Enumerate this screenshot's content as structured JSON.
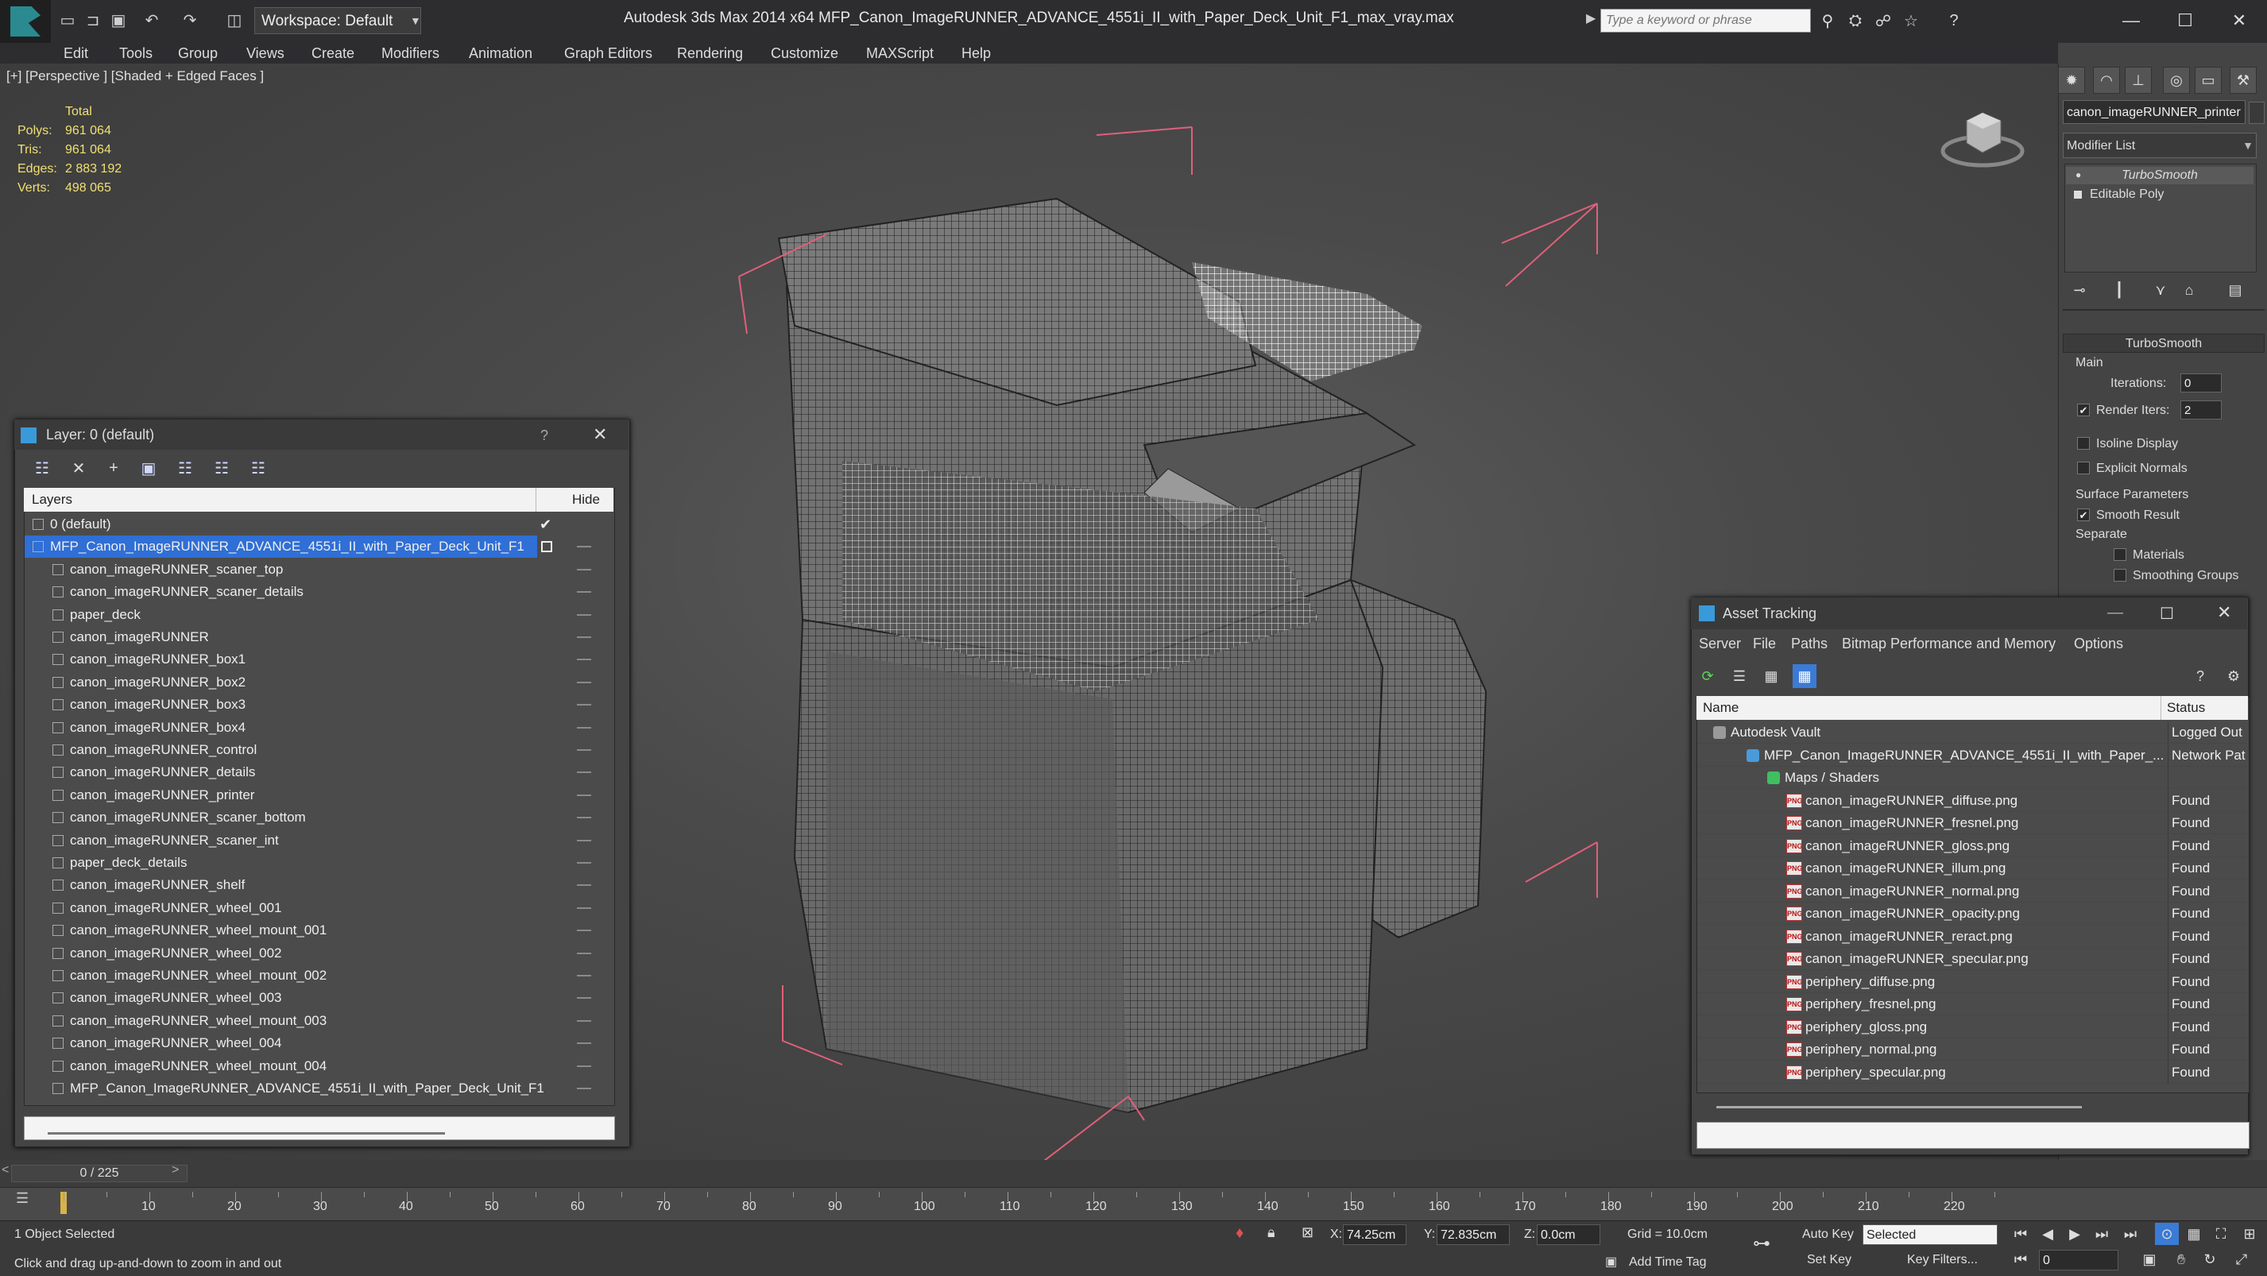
{
  "app": {
    "title": "Autodesk 3ds Max  2014 x64     MFP_Canon_ImageRUNNER_ADVANCE_4551i_II_with_Paper_Deck_Unit_F1_max_vray.max",
    "workspace": "Workspace: Default",
    "search_placeholder": "Type a keyword or phrase"
  },
  "menu": [
    "Edit",
    "Tools",
    "Group",
    "Views",
    "Create",
    "Modifiers",
    "Animation",
    "Graph Editors",
    "Rendering",
    "Customize",
    "MAXScript",
    "Help"
  ],
  "viewport": {
    "label": "[+] [Perspective ] [Shaded + Edged Faces ]",
    "stats": {
      "header": "Total",
      "polys_label": "Polys:",
      "polys": "961 064",
      "tris_label": "Tris:",
      "tris": "961 064",
      "edges_label": "Edges:",
      "edges": "2 883 192",
      "verts_label": "Verts:",
      "verts": "498 065"
    }
  },
  "command_panel": {
    "object_name": "canon_imageRUNNER_printer",
    "modifier_list": "Modifier List",
    "stack": [
      "TurboSmooth",
      "Editable Poly"
    ],
    "rollout_title": "TurboSmooth",
    "main_label": "Main",
    "iterations_label": "Iterations:",
    "iterations": "0",
    "render_iters_label": "Render Iters:",
    "render_iters": "2",
    "isoline": "Isoline Display",
    "explicit_normals": "Explicit Normals",
    "surface_params": "Surface Parameters",
    "smooth_result": "Smooth Result",
    "separate": "Separate",
    "materials": "Materials",
    "smoothing_groups": "Smoothing Groups"
  },
  "layer_dialog": {
    "title": "Layer: 0 (default)",
    "help": "?",
    "col_layers": "Layers",
    "col_hide": "Hide",
    "rows": [
      "0 (default)",
      "MFP_Canon_ImageRUNNER_ADVANCE_4551i_II_with_Paper_Deck_Unit_F1",
      "canon_imageRUNNER_scaner_top",
      "canon_imageRUNNER_scaner_details",
      "paper_deck",
      "canon_imageRUNNER",
      "canon_imageRUNNER_box1",
      "canon_imageRUNNER_box2",
      "canon_imageRUNNER_box3",
      "canon_imageRUNNER_box4",
      "canon_imageRUNNER_control",
      "canon_imageRUNNER_details",
      "canon_imageRUNNER_printer",
      "canon_imageRUNNER_scaner_bottom",
      "canon_imageRUNNER_scaner_int",
      "paper_deck_details",
      "canon_imageRUNNER_shelf",
      "canon_imageRUNNER_wheel_001",
      "canon_imageRUNNER_wheel_mount_001",
      "canon_imageRUNNER_wheel_002",
      "canon_imageRUNNER_wheel_mount_002",
      "canon_imageRUNNER_wheel_003",
      "canon_imageRUNNER_wheel_mount_003",
      "canon_imageRUNNER_wheel_004",
      "canon_imageRUNNER_wheel_mount_004",
      "MFP_Canon_ImageRUNNER_ADVANCE_4551i_II_with_Paper_Deck_Unit_F1"
    ]
  },
  "asset_dialog": {
    "title": "Asset Tracking",
    "menu": [
      "Server",
      "File",
      "Paths",
      "Bitmap Performance and Memory",
      "Options"
    ],
    "col_name": "Name",
    "col_status": "Status",
    "rows": [
      {
        "name": "Autodesk Vault",
        "status": "Logged Out"
      },
      {
        "name": "MFP_Canon_ImageRUNNER_ADVANCE_4551i_II_with_Paper_...",
        "status": "Network Pat"
      },
      {
        "name": "Maps / Shaders",
        "status": ""
      },
      {
        "name": "canon_imageRUNNER_diffuse.png",
        "status": "Found"
      },
      {
        "name": "canon_imageRUNNER_fresnel.png",
        "status": "Found"
      },
      {
        "name": "canon_imageRUNNER_gloss.png",
        "status": "Found"
      },
      {
        "name": "canon_imageRUNNER_illum.png",
        "status": "Found"
      },
      {
        "name": "canon_imageRUNNER_normal.png",
        "status": "Found"
      },
      {
        "name": "canon_imageRUNNER_opacity.png",
        "status": "Found"
      },
      {
        "name": "canon_imageRUNNER_reract.png",
        "status": "Found"
      },
      {
        "name": "canon_imageRUNNER_specular.png",
        "status": "Found"
      },
      {
        "name": "periphery_diffuse.png",
        "status": "Found"
      },
      {
        "name": "periphery_fresnel.png",
        "status": "Found"
      },
      {
        "name": "periphery_gloss.png",
        "status": "Found"
      },
      {
        "name": "periphery_normal.png",
        "status": "Found"
      },
      {
        "name": "periphery_specular.png",
        "status": "Found"
      }
    ],
    "png_tag": "PNG"
  },
  "timeline": {
    "frame": "0 / 225",
    "ticks": [
      "10",
      "20",
      "30",
      "40",
      "50",
      "60",
      "70",
      "80",
      "90",
      "100",
      "110",
      "120",
      "130",
      "140",
      "150",
      "160",
      "170",
      "180",
      "190",
      "200",
      "210",
      "220"
    ]
  },
  "statusbar": {
    "selected": "1 Object Selected",
    "hint": "Click and drag up-and-down to zoom in and out",
    "x_label": "X:",
    "x": "74.25cm",
    "y_label": "Y:",
    "y": "72.835cm",
    "z_label": "Z:",
    "z": "0.0cm",
    "grid": "Grid = 10.0cm",
    "auto_key": "Auto Key",
    "set_key": "Set Key",
    "selected_dropdown": "Selected",
    "key_filters": "Key Filters...",
    "add_time_tag": "Add Time Tag",
    "frame_field": "0"
  },
  "colors": {
    "selection_blue": "#2f6fd6",
    "gizmo_pink": "#e0607a",
    "stat_yellow": "#f0e070"
  }
}
